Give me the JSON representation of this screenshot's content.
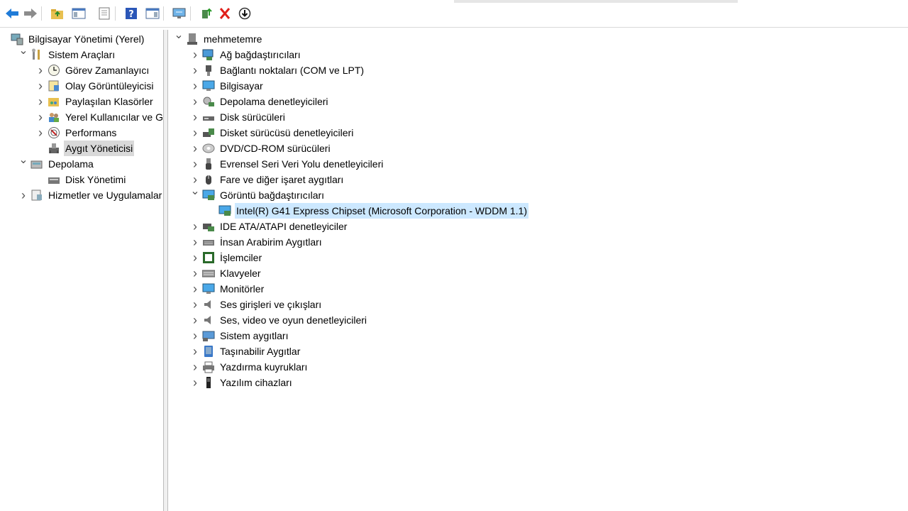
{
  "toolbar": {
    "buttons": [
      {
        "name": "back-button",
        "icon": "arrow-left-icon"
      },
      {
        "name": "forward-button",
        "icon": "arrow-right-icon"
      },
      {
        "name": "up-folder-button",
        "icon": "folder-up-icon"
      },
      {
        "name": "show-hide-console-tree-button",
        "icon": "console-tree-icon"
      },
      {
        "name": "properties-button",
        "icon": "properties-icon"
      },
      {
        "name": "help-button",
        "icon": "help-icon"
      },
      {
        "name": "show-hide-action-pane-button",
        "icon": "action-pane-icon"
      },
      {
        "name": "scan-hardware-button",
        "icon": "monitor-scan-icon"
      },
      {
        "name": "update-driver-button",
        "icon": "driver-update-icon"
      },
      {
        "name": "uninstall-device-button",
        "icon": "red-x-icon"
      },
      {
        "name": "disable-device-button",
        "icon": "down-arrow-circle-icon"
      }
    ]
  },
  "left_tree": [
    {
      "label": "Bilgisayar Yönetimi (Yerel)",
      "icon": "computer-management-icon",
      "depth": 0,
      "expander": "none"
    },
    {
      "label": "Sistem Araçları",
      "icon": "tools-icon",
      "depth": 1,
      "expander": "expanded"
    },
    {
      "label": "Görev Zamanlayıcı",
      "icon": "clock-icon",
      "depth": 2,
      "expander": "collapsed"
    },
    {
      "label": "Olay Görüntüleyicisi",
      "icon": "event-viewer-icon",
      "depth": 2,
      "expander": "collapsed"
    },
    {
      "label": "Paylaşılan Klasörler",
      "icon": "shared-folder-icon",
      "depth": 2,
      "expander": "collapsed"
    },
    {
      "label": "Yerel Kullanıcılar ve Gru",
      "icon": "users-icon",
      "depth": 2,
      "expander": "collapsed"
    },
    {
      "label": "Performans",
      "icon": "performance-icon",
      "depth": 2,
      "expander": "collapsed"
    },
    {
      "label": "Aygıt Yöneticisi",
      "icon": "device-manager-icon",
      "depth": 2,
      "expander": "none",
      "selected": true
    },
    {
      "label": "Depolama",
      "icon": "storage-icon",
      "depth": 1,
      "expander": "expanded"
    },
    {
      "label": "Disk Yönetimi",
      "icon": "disk-management-icon",
      "depth": 2,
      "expander": "none"
    },
    {
      "label": "Hizmetler ve Uygulamalar",
      "icon": "services-icon",
      "depth": 1,
      "expander": "collapsed"
    }
  ],
  "device_tree": {
    "root": {
      "label": "mehmetemre",
      "icon": "computer-icon"
    },
    "categories": [
      {
        "label": "Ağ bağdaştırıcıları",
        "icon": "network-adapter-icon",
        "expander": "collapsed"
      },
      {
        "label": "Bağlantı noktaları (COM ve LPT)",
        "icon": "port-icon",
        "expander": "collapsed"
      },
      {
        "label": "Bilgisayar",
        "icon": "monitor-icon",
        "expander": "collapsed"
      },
      {
        "label": "Depolama denetleyicileri",
        "icon": "storage-controller-icon",
        "expander": "collapsed"
      },
      {
        "label": "Disk sürücüleri",
        "icon": "disk-drive-icon",
        "expander": "collapsed"
      },
      {
        "label": "Disket sürücüsü denetleyicileri",
        "icon": "floppy-controller-icon",
        "expander": "collapsed"
      },
      {
        "label": "DVD/CD-ROM sürücüleri",
        "icon": "dvd-icon",
        "expander": "collapsed"
      },
      {
        "label": "Evrensel Seri Veri Yolu denetleyicileri",
        "icon": "usb-icon",
        "expander": "collapsed"
      },
      {
        "label": "Fare ve diğer işaret aygıtları",
        "icon": "mouse-icon",
        "expander": "collapsed"
      },
      {
        "label": "Görüntü bağdaştırıcıları",
        "icon": "display-adapter-icon",
        "expander": "expanded",
        "children": [
          {
            "label": "Intel(R) G41 Express Chipset (Microsoft Corporation - WDDM 1.1)",
            "icon": "display-adapter-icon",
            "selected": true
          }
        ]
      },
      {
        "label": "IDE ATA/ATAPI denetleyiciler",
        "icon": "ide-icon",
        "expander": "collapsed"
      },
      {
        "label": "İnsan Arabirim Aygıtları",
        "icon": "hid-icon",
        "expander": "collapsed"
      },
      {
        "label": "İşlemciler",
        "icon": "processor-icon",
        "expander": "collapsed"
      },
      {
        "label": "Klavyeler",
        "icon": "keyboard-icon",
        "expander": "collapsed"
      },
      {
        "label": "Monitörler",
        "icon": "monitor-icon",
        "expander": "collapsed"
      },
      {
        "label": "Ses girişleri ve çıkışları",
        "icon": "speaker-icon",
        "expander": "collapsed"
      },
      {
        "label": "Ses, video ve oyun denetleyicileri",
        "icon": "speaker-icon",
        "expander": "collapsed"
      },
      {
        "label": "Sistem aygıtları",
        "icon": "system-devices-icon",
        "expander": "collapsed"
      },
      {
        "label": "Taşınabilir Aygıtlar",
        "icon": "portable-device-icon",
        "expander": "collapsed"
      },
      {
        "label": "Yazdırma kuyrukları",
        "icon": "printer-icon",
        "expander": "collapsed"
      },
      {
        "label": "Yazılım cihazları",
        "icon": "software-device-icon",
        "expander": "collapsed"
      }
    ]
  },
  "colors": {
    "selection_blue": "#cce8ff",
    "selection_grey": "#d9d9d9",
    "accent": "#1f7bd8"
  }
}
